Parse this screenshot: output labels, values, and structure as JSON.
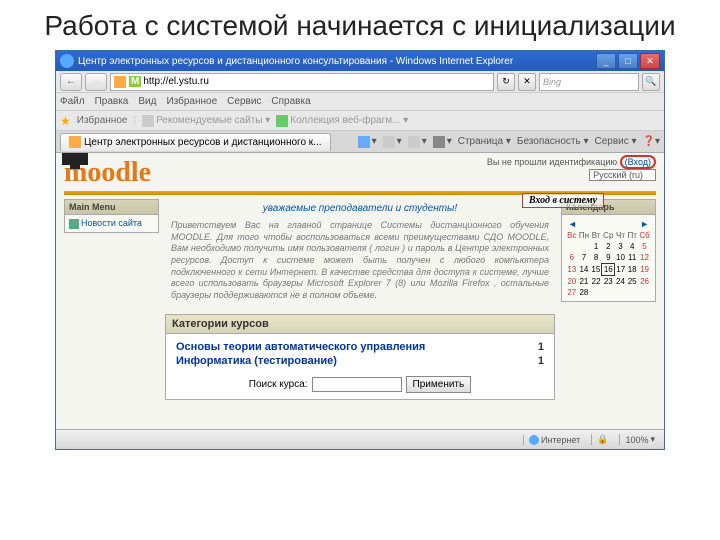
{
  "slide": {
    "title": "Работа с системой начинается с инициализации"
  },
  "titlebar": {
    "text": "Центр электронных ресурсов и дистанционного консультирования - Windows Internet Explorer"
  },
  "winbtns": {
    "min": "_",
    "max": "□",
    "close": "✕"
  },
  "nav": {
    "back": "←",
    "fwd": "→",
    "url_prefix": "M",
    "url": "http://el.ystu.ru",
    "refresh": "↻",
    "stop": "✕",
    "search_placeholder": "Bing",
    "search_icon": "🔍"
  },
  "menu": {
    "file": "Файл",
    "edit": "Правка",
    "view": "Вид",
    "favorites": "Избранное",
    "tools": "Сервис",
    "help": "Справка"
  },
  "favbar": {
    "label": "Избранное",
    "item1": "Рекомендуемые сайты ▾",
    "item2": "Коллекция веб-фрагм... ▾"
  },
  "tab": {
    "text": "Центр электронных ресурсов и дистанционного к..."
  },
  "toolrow": {
    "home": "▾",
    "page": "Страница ▾",
    "safety": "Безопасность ▾",
    "svc": "Сервис ▾",
    "help": "❓▾"
  },
  "login": {
    "msg_prefix": "Вы не прошли идентификацию ",
    "link": "(Вход)",
    "lang": "Русский (ru)"
  },
  "callout": {
    "text": "Вход в систему"
  },
  "logo": {
    "text": "moodle"
  },
  "mainmenu": {
    "title": "Main Menu",
    "news": "Новости сайта"
  },
  "welcome": {
    "text": "уважаемые преподаватели и студенты!"
  },
  "intro": {
    "text": "Приветствуем Вас на главной странице Системы дистанционного обучения MOODLE. Для того чтобы воспользоваться всеми преимуществами СДО MOODLE, Вам необходимо получить имя пользователя ( логин ) и пароль в Центре электронных ресурсов. Доступ к системе может быть получен с любого компьютера подключенного к сети Интернет. В качестве средства для доступа к системе, лучше всего использовать браузеры Microsoft Explorer 7 (8) или Mozilla Firefox , остальные браузеры поддерживаются не в полном объеме."
  },
  "categories": {
    "header": "Категории курсов",
    "rows": [
      {
        "name": "Основы теории автоматического управления",
        "count": "1"
      },
      {
        "name": "Информатика (тестирование)",
        "count": "1"
      }
    ]
  },
  "search": {
    "label": "Поиск курса:",
    "btn": "Применить"
  },
  "calendar": {
    "title": "Календарь",
    "prev": "◄",
    "next": "►",
    "days": [
      "Вс",
      "Пн",
      "Вт",
      "Ср",
      "Чт",
      "Пт",
      "Сб"
    ],
    "weeks": [
      [
        "",
        "",
        "1",
        "2",
        "3",
        "4",
        "5"
      ],
      [
        "6",
        "7",
        "8",
        "9",
        "10",
        "11",
        "12"
      ],
      [
        "13",
        "14",
        "15",
        "16",
        "17",
        "18",
        "19"
      ],
      [
        "20",
        "21",
        "22",
        "23",
        "24",
        "25",
        "26"
      ],
      [
        "27",
        "28",
        "",
        "",
        "",
        "",
        ""
      ]
    ],
    "today": "16"
  },
  "status": {
    "internet": "Интернет",
    "zoom": "100%"
  }
}
